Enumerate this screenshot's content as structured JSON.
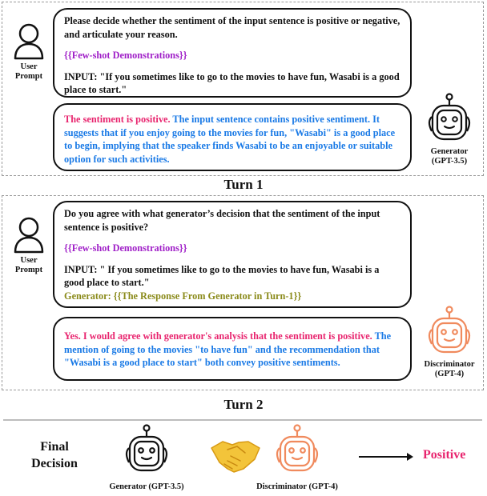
{
  "colors": {
    "accent_pink": "#e8246e",
    "accent_blue": "#1a7ae6",
    "placeholder_purple": "#a020c8",
    "placeholder_olive": "#8a8a1a",
    "discriminator_orange": "#f08a5d"
  },
  "turn1": {
    "user_label_line1": "User",
    "user_label_line2": "Prompt",
    "prompt_line1": "Please decide whether the sentiment of the input sentence is positive or negative, and articulate your reason.",
    "few_shot": "{{Few-shot Demonstrations}}",
    "input": "INPUT: \"If you sometimes like to go to the movies to have fun, Wasabi is a good place to start.\"",
    "response_verdict": "The sentiment is positive.",
    "response_reason": " The input sentence contains positive sentiment. It suggests that if you enjoy going to the movies for fun, \"Wasabi\" is a good place to begin, implying that the speaker finds Wasabi to be an enjoyable or suitable option for such activities.",
    "bot_label_line1": "Generator",
    "bot_label_line2": "(GPT-3.5)",
    "bot_icon": "robot-icon",
    "turn_label": "Turn 1"
  },
  "turn2": {
    "user_label_line1": "User",
    "user_label_line2": "Prompt",
    "prompt_line1": "Do you agree with what generator’s decision that the sentiment of the input sentence is positive?",
    "few_shot": "{{Few-shot Demonstrations}}",
    "input": "INPUT: \" If you sometimes like to go to the movies to have fun, Wasabi is a good place to start.\"",
    "generator_ref": "Generator: {{The Response From Generator in Turn-1}}",
    "response_verdict": "Yes. I would agree with generator's analysis that the sentiment is positive.",
    "response_reason": " The mention of going to the movies \"to have fun\" and the recommendation that \"Wasabi is a good place to start\" both convey positive sentiments.",
    "bot_label_line1": "Discriminator",
    "bot_label_line2": "(GPT-4)",
    "bot_icon": "robot-icon",
    "turn_label": "Turn 2"
  },
  "final": {
    "label_line1": "Final",
    "label_line2": "Decision",
    "generator_caption": "Generator (GPT-3.5)",
    "handshake_icon": "handshake-icon",
    "discriminator_caption": "Discriminator (GPT-4)",
    "result": "Positive"
  }
}
